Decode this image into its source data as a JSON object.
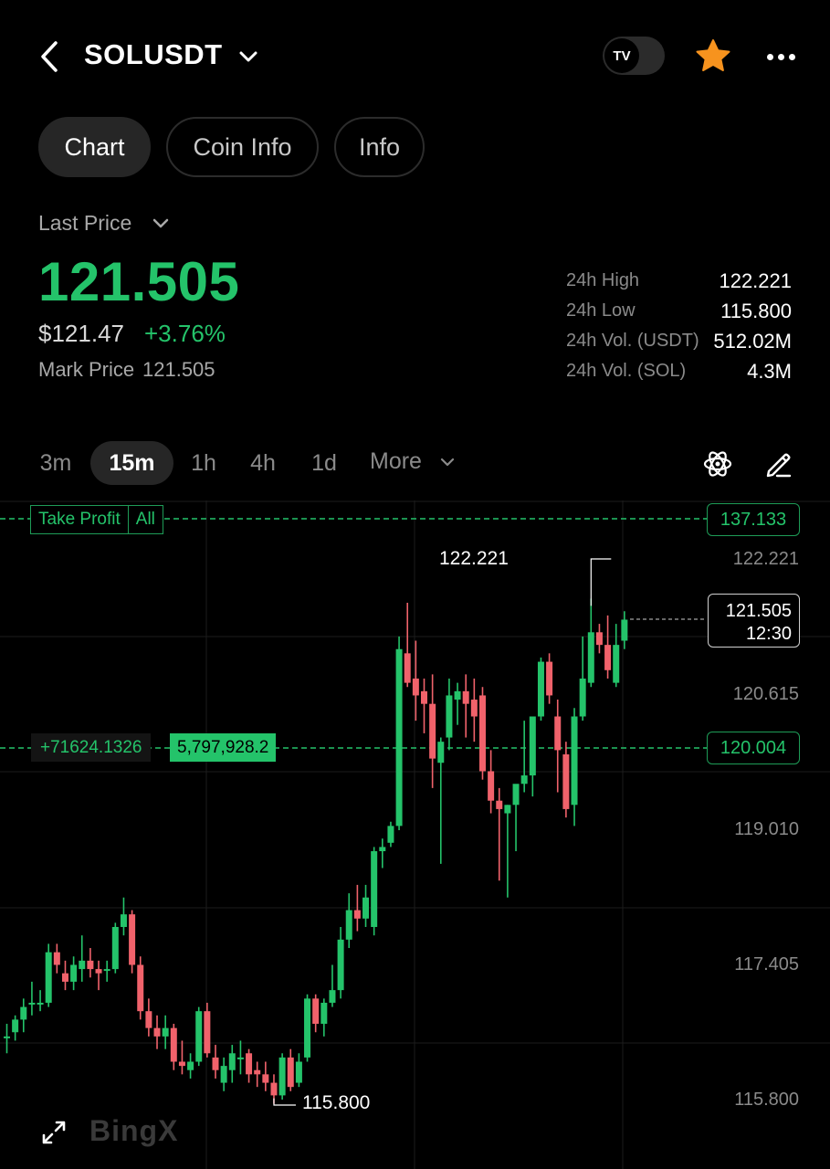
{
  "header": {
    "pair": "SOLUSDT",
    "tv_icon_text": "TV",
    "back_icon": "chevron-left-icon",
    "favorite_icon": "star-icon",
    "favorite_color": "#f7931e",
    "more_icon": "more-horizontal-icon"
  },
  "tabs": [
    {
      "label": "Chart",
      "active": true
    },
    {
      "label": "Coin Info",
      "active": false
    },
    {
      "label": "Info",
      "active": false
    }
  ],
  "price": {
    "label": "Last Price",
    "last": "121.505",
    "usd": "$121.47",
    "change": "+3.76%",
    "mark_label": "Mark Price",
    "mark_value": "121.505",
    "up_color": "#24c36a",
    "down_color": "#f0626b"
  },
  "stats": [
    {
      "label": "24h High",
      "value": "122.221"
    },
    {
      "label": "24h Low",
      "value": "115.800"
    },
    {
      "label": "24h Vol. (USDT)",
      "value": "512.02M"
    },
    {
      "label": "24h Vol. (SOL)",
      "value": "4.3M"
    }
  ],
  "intervals": [
    {
      "label": "3m",
      "active": false
    },
    {
      "label": "15m",
      "active": true
    },
    {
      "label": "1h",
      "active": false
    },
    {
      "label": "4h",
      "active": false
    },
    {
      "label": "1d",
      "active": false
    }
  ],
  "more_label": "More",
  "toolbar_icons": {
    "indicators": "atom-indicator-icon",
    "draw": "pencil-icon",
    "expand": "expand-icon"
  },
  "chart": {
    "take_profit_label": "Take Profit",
    "take_profit_all": "All",
    "take_profit_price": "137.133",
    "position_pnl": "+71624.1326",
    "position_qty": "5,797,928.2",
    "entry_price": "120.004",
    "current_price": "121.505",
    "countdown": "12:30",
    "high_label": "122.221",
    "low_label": "115.800",
    "axis_labels": [
      "122.221",
      "120.615",
      "119.010",
      "117.405",
      "115.800"
    ],
    "watermark": "BingX"
  },
  "chart_data": {
    "type": "candlestick",
    "interval": "15m",
    "ylim": [
      115.2,
      122.8
    ],
    "y_ticks": [
      122.221,
      120.615,
      119.01,
      117.405,
      115.8
    ],
    "candles": [
      [
        116.55,
        116.7,
        116.35,
        116.55
      ],
      [
        116.6,
        116.8,
        116.5,
        116.75
      ],
      [
        116.75,
        117.0,
        116.6,
        116.9
      ],
      [
        116.95,
        117.2,
        116.8,
        116.95
      ],
      [
        116.95,
        117.1,
        116.85,
        116.95
      ],
      [
        116.95,
        117.65,
        116.9,
        117.55
      ],
      [
        117.55,
        117.65,
        117.3,
        117.4
      ],
      [
        117.3,
        117.45,
        117.1,
        117.2
      ],
      [
        117.2,
        117.5,
        117.1,
        117.4
      ],
      [
        117.35,
        117.75,
        117.2,
        117.45
      ],
      [
        117.45,
        117.6,
        117.25,
        117.35
      ],
      [
        117.35,
        117.45,
        117.1,
        117.3
      ],
      [
        117.35,
        117.45,
        117.2,
        117.35
      ],
      [
        117.35,
        117.9,
        117.3,
        117.85
      ],
      [
        117.85,
        118.2,
        117.75,
        118.0
      ],
      [
        118.0,
        118.05,
        117.3,
        117.4
      ],
      [
        117.4,
        117.5,
        116.75,
        116.85
      ],
      [
        116.85,
        117.0,
        116.55,
        116.65
      ],
      [
        116.65,
        116.8,
        116.4,
        116.55
      ],
      [
        116.55,
        116.8,
        116.4,
        116.65
      ],
      [
        116.65,
        116.7,
        116.15,
        116.25
      ],
      [
        116.25,
        116.5,
        116.1,
        116.2
      ],
      [
        116.15,
        116.35,
        116.05,
        116.25
      ],
      [
        116.25,
        116.9,
        116.2,
        116.85
      ],
      [
        116.85,
        116.95,
        116.3,
        116.35
      ],
      [
        116.3,
        116.45,
        116.05,
        116.15
      ],
      [
        116.0,
        116.3,
        115.9,
        116.2
      ],
      [
        116.15,
        116.45,
        116.0,
        116.35
      ],
      [
        116.3,
        116.5,
        116.1,
        116.3
      ],
      [
        116.35,
        116.4,
        116.0,
        116.1
      ],
      [
        116.15,
        116.25,
        115.95,
        116.1
      ],
      [
        116.1,
        116.25,
        115.9,
        116.0
      ],
      [
        116.0,
        116.1,
        115.75,
        115.85
      ],
      [
        115.85,
        116.35,
        115.8,
        116.3
      ],
      [
        116.3,
        116.4,
        115.9,
        115.95
      ],
      [
        116.0,
        116.35,
        115.95,
        116.25
      ],
      [
        116.3,
        117.05,
        116.25,
        117.0
      ],
      [
        117.0,
        117.05,
        116.6,
        116.7
      ],
      [
        116.7,
        117.0,
        116.55,
        116.95
      ],
      [
        116.95,
        117.4,
        116.9,
        117.1
      ],
      [
        117.1,
        117.85,
        117.0,
        117.7
      ],
      [
        117.7,
        118.25,
        117.6,
        118.05
      ],
      [
        118.05,
        118.35,
        117.8,
        117.95
      ],
      [
        117.95,
        118.35,
        117.85,
        118.2
      ],
      [
        117.85,
        118.8,
        117.75,
        118.75
      ],
      [
        118.75,
        118.9,
        118.55,
        118.8
      ],
      [
        118.85,
        119.1,
        118.8,
        119.05
      ],
      [
        119.05,
        121.3,
        119.0,
        121.15
      ],
      [
        121.1,
        121.7,
        120.7,
        120.75
      ],
      [
        120.8,
        121.25,
        120.3,
        120.6
      ],
      [
        120.65,
        120.8,
        120.15,
        120.5
      ],
      [
        120.5,
        120.85,
        119.5,
        119.85
      ],
      [
        119.8,
        120.1,
        118.6,
        120.05
      ],
      [
        120.1,
        120.8,
        119.95,
        120.6
      ],
      [
        120.55,
        120.75,
        120.25,
        120.65
      ],
      [
        120.65,
        120.85,
        120.1,
        120.5
      ],
      [
        120.55,
        120.8,
        120.05,
        120.35
      ],
      [
        120.6,
        120.7,
        119.6,
        119.7
      ],
      [
        119.7,
        119.95,
        119.2,
        119.35
      ],
      [
        119.35,
        119.5,
        118.4,
        119.25
      ],
      [
        119.2,
        119.3,
        118.2,
        119.3
      ],
      [
        119.3,
        119.5,
        118.75,
        119.55
      ],
      [
        119.55,
        120.3,
        119.45,
        119.65
      ],
      [
        119.65,
        120.3,
        119.4,
        120.35
      ],
      [
        120.35,
        121.05,
        120.3,
        121.0
      ],
      [
        121.0,
        121.1,
        120.5,
        120.6
      ],
      [
        120.35,
        120.55,
        119.45,
        119.95
      ],
      [
        119.9,
        120.05,
        119.15,
        119.25
      ],
      [
        119.3,
        120.45,
        119.05,
        120.35
      ],
      [
        120.35,
        121.3,
        120.3,
        120.8
      ],
      [
        120.75,
        121.75,
        120.7,
        121.35
      ],
      [
        121.35,
        121.45,
        121.1,
        121.2
      ],
      [
        121.2,
        121.55,
        120.8,
        120.9
      ],
      [
        120.75,
        121.45,
        120.7,
        121.2
      ],
      [
        121.25,
        121.6,
        121.15,
        121.5
      ]
    ]
  }
}
